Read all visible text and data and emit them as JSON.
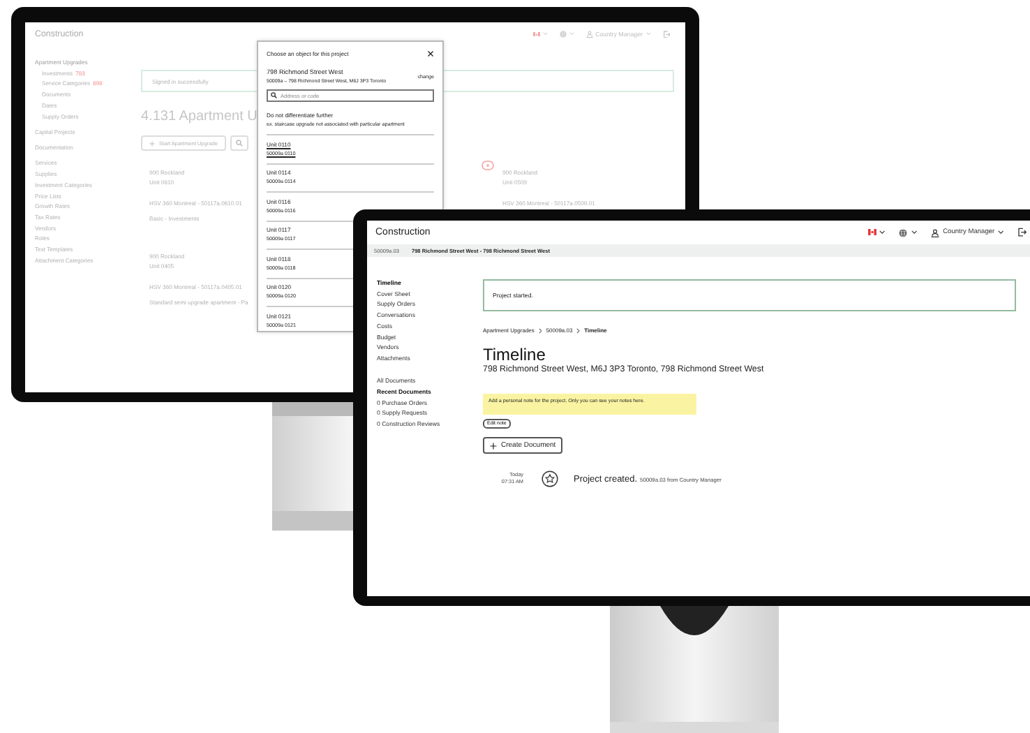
{
  "back_screen": {
    "app_title": "Construction",
    "header": {
      "user": "Country Manager"
    },
    "sidebar": {
      "sections": [
        {
          "items": [
            {
              "label": "Apartment Upgrades",
              "children": [
                {
                  "label": "Investments",
                  "count": "783"
                },
                {
                  "label": "Service Categories",
                  "count": "698"
                },
                {
                  "label": "Documents"
                },
                {
                  "label": "Dates"
                },
                {
                  "label": "Supply Orders"
                }
              ]
            }
          ]
        },
        {
          "items": [
            {
              "label": "Capital Projects"
            }
          ]
        },
        {
          "items": [
            {
              "label": "Documentation"
            }
          ]
        },
        {
          "items": [
            {
              "label": "Services"
            },
            {
              "label": "Supplies"
            },
            {
              "label": "Investment Categories"
            },
            {
              "label": "Price Lists"
            },
            {
              "label": "Growth Rates"
            },
            {
              "label": "Tax Rates"
            },
            {
              "label": "Vendors"
            },
            {
              "label": "Roles"
            },
            {
              "label": "Text Templates"
            },
            {
              "label": "Attachment Categories"
            }
          ]
        }
      ]
    },
    "banner": "Signed in successfully",
    "heading": "4.131 Apartment U",
    "start_button": "Start Apartment Upgrade",
    "cards": [
      {
        "title": "900 Rockland",
        "unit": "Unit 0610",
        "code": "HSV 360 Montreal - 50117a.0610.01",
        "note": "Basic - Investments"
      },
      {
        "title": "900 Rockland",
        "unit": "Unit 0405",
        "code": "HSV 360 Montreal - 50117a.0405.01",
        "note": "Standard semi upgrade apartment - Pa"
      }
    ],
    "side_cards": [
      {
        "title": "900 Rockland",
        "unit": "Unit 0509",
        "code": "HSV 360 Montreal - 50117a.0509.01"
      }
    ],
    "dialog": {
      "title": "Choose an object for this project",
      "object": {
        "name": "798 Richmond Street West",
        "address": "50009a – 798 Richmond Street West, M6J 3P3 Toronto",
        "change_link": "change"
      },
      "search": {
        "placeholder": "Address or code"
      },
      "no_differentiation": {
        "title": "Do not differentiate further",
        "hint": "ex. staircase upgrade not associated with particular apartment"
      },
      "units": [
        {
          "name": "Unit 0110",
          "code": "50009a 0110",
          "selected": true
        },
        {
          "name": "Unit 0114",
          "code": "50009a 0114",
          "selected": false
        },
        {
          "name": "Unit 0116",
          "code": "50009a 0116",
          "selected": false
        },
        {
          "name": "Unit 0117",
          "code": "50009a 0117",
          "selected": false
        },
        {
          "name": "Unit 0118",
          "code": "50009a 0118",
          "selected": false
        },
        {
          "name": "Unit 0120",
          "code": "50009a 0120",
          "selected": false
        },
        {
          "name": "Unit 0121",
          "code": "50009a 0121",
          "selected": false
        }
      ]
    }
  },
  "front_screen": {
    "app_title": "Construction",
    "header": {
      "user": "Country Manager"
    },
    "project_bar": {
      "code": "50009a.03",
      "title": "798 Richmond Street West - 798 Richmond Street West"
    },
    "sidebar": {
      "groups": [
        {
          "items": [
            {
              "label": "Timeline",
              "kind": "link",
              "selected": true
            },
            {
              "label": "Cover Sheet",
              "kind": "link",
              "selected": false
            },
            {
              "label": "Supply Orders",
              "kind": "link",
              "selected": false
            },
            {
              "label": "Conversations",
              "kind": "link",
              "selected": false
            },
            {
              "label": "Costs",
              "kind": "link",
              "selected": false
            },
            {
              "label": "Budget",
              "kind": "link",
              "selected": false
            },
            {
              "label": "Vendors",
              "kind": "link",
              "selected": false
            },
            {
              "label": "Attachments",
              "kind": "link",
              "selected": false
            }
          ]
        },
        {
          "items": [
            {
              "label": "All Documents",
              "kind": "link",
              "selected": false
            },
            {
              "label": "Recent Documents",
              "kind": "heading"
            },
            {
              "label": "0 Purchase Orders",
              "kind": "link",
              "selected": false
            },
            {
              "label": "0 Supply Requests",
              "kind": "link",
              "selected": false
            },
            {
              "label": "0 Construction Reviews",
              "kind": "link",
              "selected": false
            }
          ]
        }
      ]
    },
    "alert": "Project started.",
    "breadcrumb": [
      {
        "label": "Apartment Upgrades",
        "selected": false
      },
      {
        "label": "50009a.03",
        "selected": false
      },
      {
        "label": "Timeline",
        "selected": true
      }
    ],
    "title": "Timeline",
    "subtitle": "798 Richmond Street West, M6J 3P3 Toronto, 798 Richmond Street West",
    "note": "Add a personal note for the project. Only you can see your notes here.",
    "edit_note_button": "Edit note",
    "create_button": "Create Document",
    "events": [
      {
        "date": "Today",
        "time": "07:31 AM",
        "title": "Project created.",
        "detail": "50009a.03 from Country Manager"
      }
    ]
  }
}
